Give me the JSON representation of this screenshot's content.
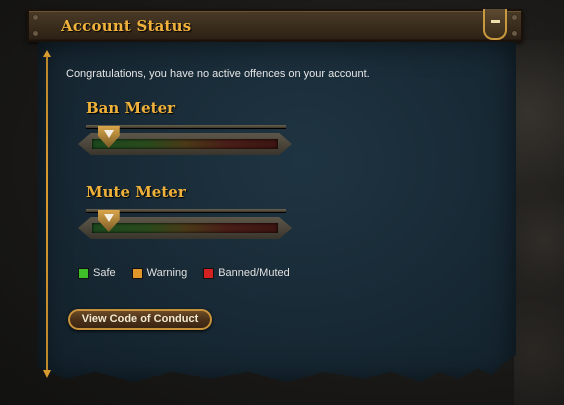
{
  "header": {
    "title": "Account Status",
    "collapse_icon": "minus-icon"
  },
  "main": {
    "message": "Congratulations, you have no active offences on your account."
  },
  "meters": [
    {
      "title": "Ban Meter",
      "level": 0.09
    },
    {
      "title": "Mute Meter",
      "level": 0.09
    }
  ],
  "legend": [
    {
      "label": "Safe",
      "color": "#3fbf2a"
    },
    {
      "label": "Warning",
      "color": "#e0962a"
    },
    {
      "label": "Banned/Muted",
      "color": "#d42222"
    }
  ],
  "actions": {
    "code_of_conduct_label": "View Code of Conduct"
  },
  "colors": {
    "accent": "#f0b23b",
    "panel": "#182a36"
  }
}
